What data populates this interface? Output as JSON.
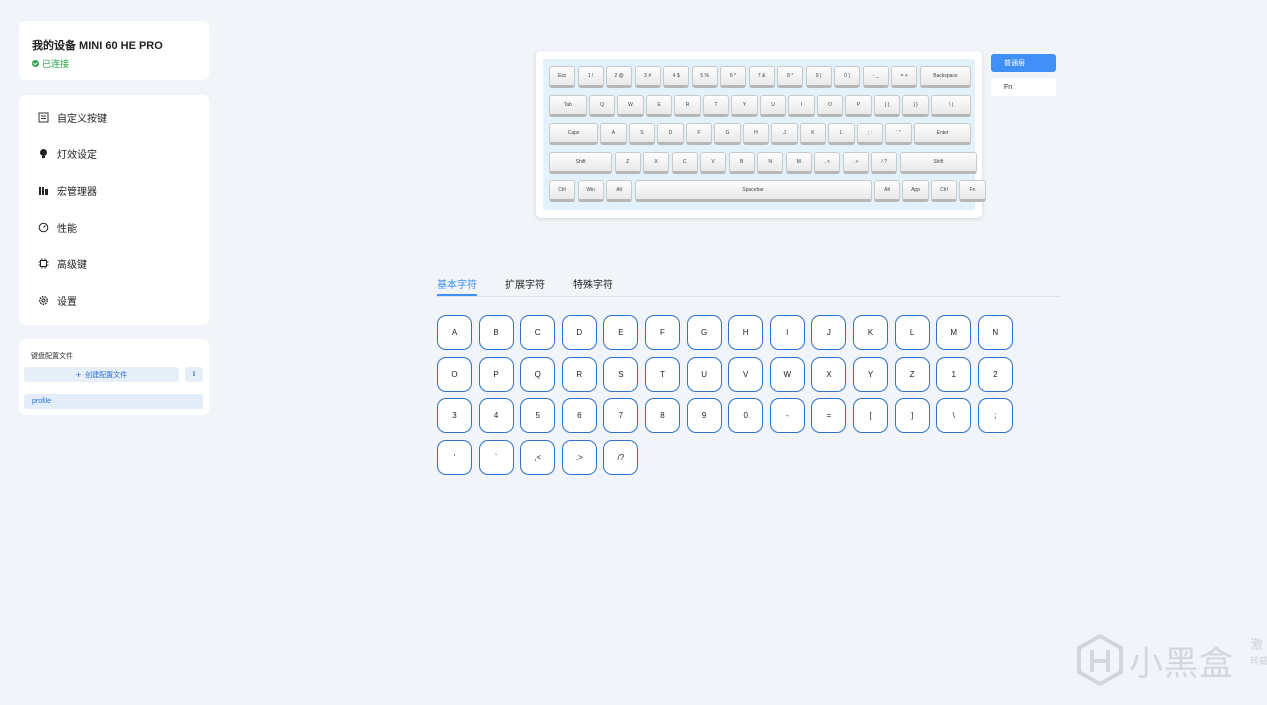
{
  "device": {
    "title": "我的设备 MINI 60 HE PRO",
    "status": "已连接",
    "status_color": "#2aa049"
  },
  "nav": {
    "items": [
      {
        "label": "自定义按键",
        "icon": "keyboard-icon"
      },
      {
        "label": "灯效设定",
        "icon": "bulb-icon"
      },
      {
        "label": "宏管理器",
        "icon": "macro-icon"
      },
      {
        "label": "性能",
        "icon": "gauge-icon"
      },
      {
        "label": "高级键",
        "icon": "chip-icon"
      },
      {
        "label": "设置",
        "icon": "gear-icon"
      }
    ]
  },
  "profiles": {
    "title": "键盘配置文件",
    "create_label": "创建配置文件",
    "create_icon": "plus-icon",
    "import_icon": "import-icon",
    "items": [
      "profile"
    ]
  },
  "keyboard": {
    "layers": [
      "普通层",
      "Fn"
    ],
    "active_layer": "普通层",
    "rows": [
      [
        "Esc",
        "1 !",
        "2 @",
        "3 #",
        "4 $",
        "5 %",
        "6 ^",
        "7 &",
        "8 *",
        "9 (",
        "0 )",
        "- _",
        "= +",
        "Backspace"
      ],
      [
        "Tab",
        "Q",
        "W",
        "E",
        "R",
        "T",
        "Y",
        "U",
        "I",
        "O",
        "P",
        "[ {",
        "] }",
        "\\ |"
      ],
      [
        "Caps",
        "A",
        "S",
        "D",
        "F",
        "G",
        "H",
        "J",
        "K",
        "L",
        "; :",
        "' \"",
        "Enter"
      ],
      [
        "Shift",
        "Z",
        "X",
        "C",
        "V",
        "B",
        "N",
        "M",
        ", <",
        ". >",
        "/ ?",
        "Shift"
      ],
      [
        "Ctrl",
        "Win",
        "Alt",
        "Spacebar",
        "Alt",
        "App",
        "Ctrl",
        "Fn"
      ]
    ]
  },
  "tabs": [
    "基本字符",
    "扩展字符",
    "特殊字符"
  ],
  "active_tab": "基本字符",
  "chars": [
    "A",
    "B",
    "C",
    "D",
    "E",
    "F",
    "G",
    "H",
    "I",
    "J",
    "K",
    "L",
    "M",
    "N",
    "O",
    "P",
    "Q",
    "R",
    "S",
    "T",
    "U",
    "V",
    "W",
    "X",
    "Y",
    "Z",
    "1",
    "2",
    "3",
    "4",
    "5",
    "6",
    "7",
    "8",
    "9",
    "0",
    "-",
    "=",
    "[",
    "]",
    "\\",
    ";",
    "'",
    "`",
    ",<",
    ".>",
    "/?"
  ],
  "watermark": {
    "text": "小黑盒",
    "side_1": "激",
    "side_2": "转载"
  },
  "colors": {
    "accent": "#3f8ff7",
    "key_border": "#2f73c8",
    "background": "#f1f4f8"
  }
}
